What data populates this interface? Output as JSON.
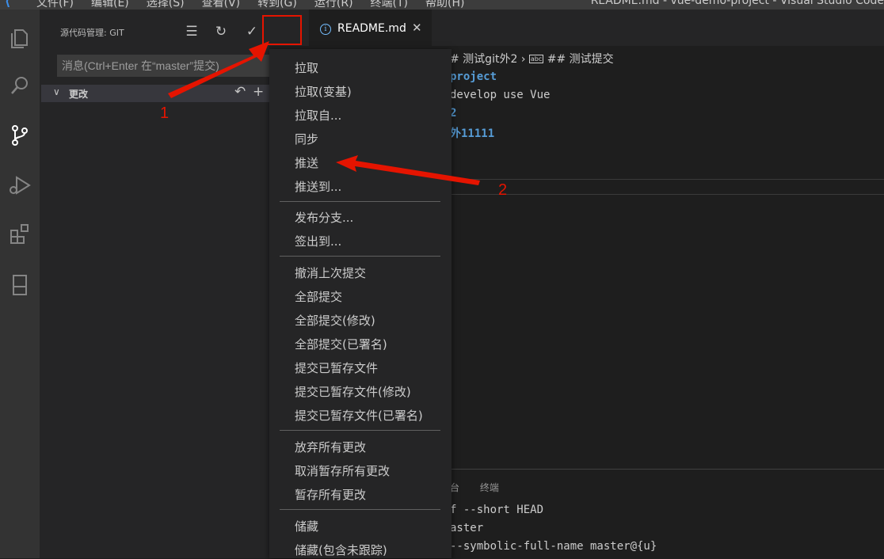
{
  "titlebar": {
    "menu": [
      "文件(F)",
      "编辑(E)",
      "选择(S)",
      "查看(V)",
      "转到(G)",
      "运行(R)",
      "终端(T)",
      "帮助(H)"
    ],
    "window_title": "README.md - vue-demo-project - Visual Studio Code"
  },
  "activity_bar": {
    "icons": [
      "explorer-icon",
      "search-icon",
      "source-control-icon",
      "run-debug-icon",
      "extensions-icon",
      "remote-icon"
    ]
  },
  "sidebar": {
    "title": "源代码管理: GIT",
    "commit_placeholder": "消息(Ctrl+Enter 在“master”提交)",
    "changes_label": "更改"
  },
  "editor": {
    "tab_name": "README.md",
    "breadcrumb": [
      "# 测试git外2",
      "## 测试提交"
    ],
    "lines": [
      "project",
      "develop use Vue",
      "2",
      "外11111"
    ]
  },
  "panel": {
    "tabs": [
      "台",
      "终端"
    ],
    "terminal_lines": [
      "f --short HEAD",
      "aster",
      "--symbolic-full-name master@{u}"
    ]
  },
  "context_menu": {
    "groups": [
      [
        "拉取",
        "拉取(变基)",
        "拉取自...",
        "同步",
        "推送",
        "推送到..."
      ],
      [
        "发布分支...",
        "签出到..."
      ],
      [
        "撤消上次提交",
        "全部提交",
        "全部提交(修改)",
        "全部提交(已署名)",
        "提交已暂存文件",
        "提交已暂存文件(修改)",
        "提交已暂存文件(已署名)"
      ],
      [
        "放弃所有更改",
        "取消暂存所有更改",
        "暂存所有更改"
      ],
      [
        "储藏",
        "储藏(包含未跟踪)"
      ]
    ]
  },
  "annotations": {
    "label_1": "1",
    "label_2": "2",
    "color": "#e51400"
  }
}
